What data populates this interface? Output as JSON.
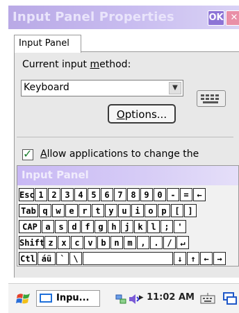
{
  "window": {
    "title": "Input Panel Properties",
    "ok_label": "OK",
    "close_label": "✕"
  },
  "tabs": [
    {
      "label": "Input Panel",
      "active": true
    }
  ],
  "current_method": {
    "label_pre": "Current input ",
    "label_accel": "m",
    "label_post": "ethod:",
    "value": "Keyboard"
  },
  "options_button": {
    "label_accel": "O",
    "label_rest": "ptions..."
  },
  "allow_checkbox": {
    "checked": true,
    "label_accel": "A",
    "label_rest": "llow applications to change the"
  },
  "input_panel": {
    "title": "Input Panel",
    "rows": [
      [
        "Esc",
        "1",
        "2",
        "3",
        "4",
        "5",
        "6",
        "7",
        "8",
        "9",
        "0",
        "-",
        "=",
        "←"
      ],
      [
        "Tab",
        "q",
        "w",
        "e",
        "r",
        "t",
        "y",
        "u",
        "i",
        "o",
        "p",
        "[",
        "]"
      ],
      [
        "CAP",
        "a",
        "s",
        "d",
        "f",
        "g",
        "h",
        "j",
        "k",
        "l",
        ";",
        "'"
      ],
      [
        "Shift",
        "z",
        "x",
        "c",
        "v",
        "b",
        "n",
        "m",
        ",",
        ".",
        "/",
        "↵"
      ],
      [
        "Ctl",
        "áü",
        "`",
        "\\",
        "",
        "↓",
        "↑",
        "←",
        "→"
      ]
    ]
  },
  "taskbar": {
    "app_label": "Inpu...",
    "clock": "11:02 AM",
    "icons": [
      "start-flag-icon",
      "network-icon",
      "speaker-icon",
      "keyboard-icon",
      "desktop-icon"
    ]
  },
  "colors": {
    "titlebar": "#b9a9e6",
    "ok": "#8d74d6",
    "close": "#e98fa7",
    "check": "#1b7d2e"
  }
}
